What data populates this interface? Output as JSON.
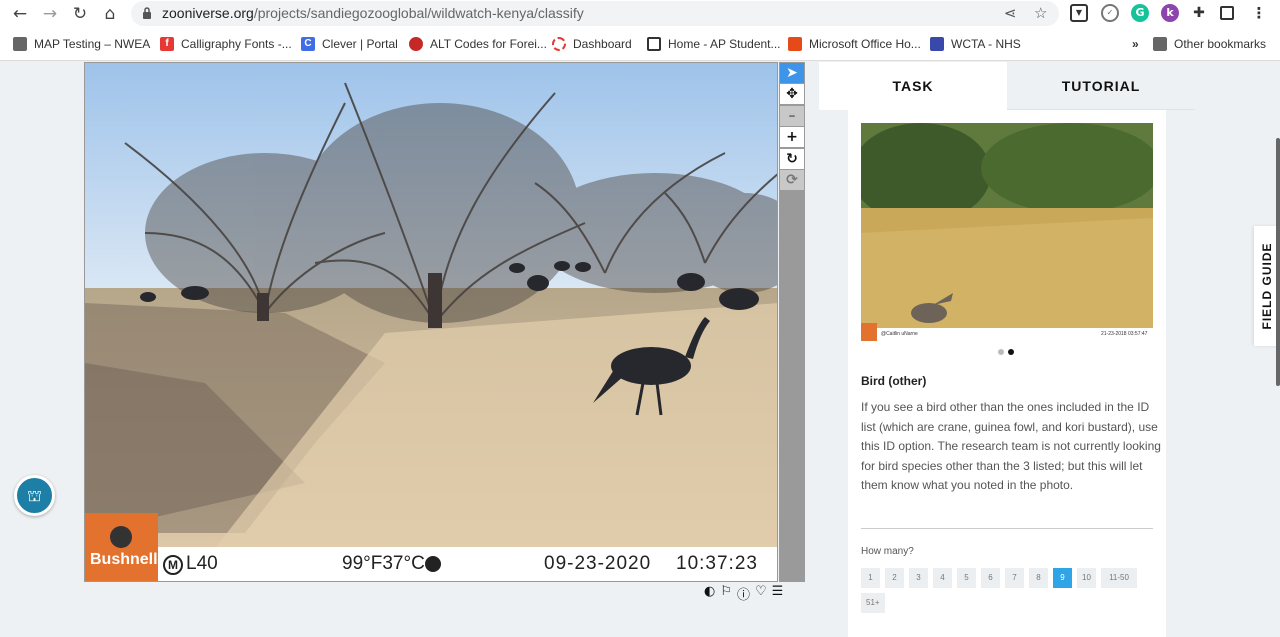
{
  "browser": {
    "url_domain": "zooniverse.org",
    "url_path": "/projects/sandiegozooglobal/wildwatch-kenya/classify",
    "back_icon": "arrow-left-icon",
    "forward_icon": "arrow-right-icon",
    "reload_icon": "reload-icon",
    "home_icon": "home-icon"
  },
  "bookmarks": {
    "items": [
      {
        "label": "MAP Testing – NWEA",
        "icon": "briefcase-icon",
        "color": "#555555"
      },
      {
        "label": "Calligraphy Fonts -...",
        "icon": "calligraphy-icon",
        "color": "#e53935"
      },
      {
        "label": "Clever | Portal",
        "icon": "clever-icon",
        "color": "#3f6de6"
      },
      {
        "label": "ALT Codes for Forei...",
        "icon": "alt-codes-icon",
        "color": "#c62828"
      },
      {
        "label": "Dashboard",
        "icon": "dashboard-icon",
        "color": "#e53935"
      },
      {
        "label": "Home - AP Student...",
        "icon": "ap-icon",
        "color": "#333333"
      },
      {
        "label": "Microsoft Office Ho...",
        "icon": "office-icon",
        "color": "#e64a19"
      },
      {
        "label": "WCTA - NHS",
        "icon": "wcta-icon",
        "color": "#3949ab"
      }
    ],
    "overflow": "»",
    "other": "Other bookmarks"
  },
  "subject": {
    "camera_brand": "Bushnell",
    "camera_model_badge": "M",
    "camera_model": "L40",
    "temperature": "99°F37°C",
    "date": "09-23-2020",
    "time": "10:37:23"
  },
  "toolbar": {
    "tools": [
      {
        "name": "annotate-tool",
        "icon": "cursor-icon",
        "glyph": "➤"
      },
      {
        "name": "move-tool",
        "icon": "move-icon",
        "glyph": "✥"
      },
      {
        "name": "zoom-out-tool",
        "icon": "zoom-out-icon",
        "glyph": "–"
      },
      {
        "name": "zoom-in-tool",
        "icon": "zoom-in-icon",
        "glyph": "+"
      },
      {
        "name": "rotate-tool",
        "icon": "rotate-icon",
        "glyph": "↻"
      },
      {
        "name": "reset-tool",
        "icon": "reset-icon",
        "glyph": "⟳"
      }
    ]
  },
  "image_actions": [
    "invert-icon",
    "flag-icon",
    "info-icon",
    "heart-icon",
    "collections-icon"
  ],
  "task_panel": {
    "tab_task": "TASK",
    "tab_tutorial": "TUTORIAL",
    "choice_title": "Bird (other)",
    "choice_description": "If you see a bird other than the ones included in the ID list (which are crane, guinea fowl, and kori bustard), use this ID option. The research team is not currently looking for bird species other than the 3 listed; but this will let them know what you noted in the photo.",
    "how_many_label": "How many?",
    "counts": [
      "1",
      "2",
      "3",
      "4",
      "5",
      "6",
      "7",
      "8",
      "9",
      "10",
      "11-50",
      "51+"
    ],
    "selected_count": "9",
    "example_credit": "@Caitlin uNarne",
    "example_date": "21-23-2018 03:57:47"
  },
  "field_guide": "FIELD GUIDE"
}
